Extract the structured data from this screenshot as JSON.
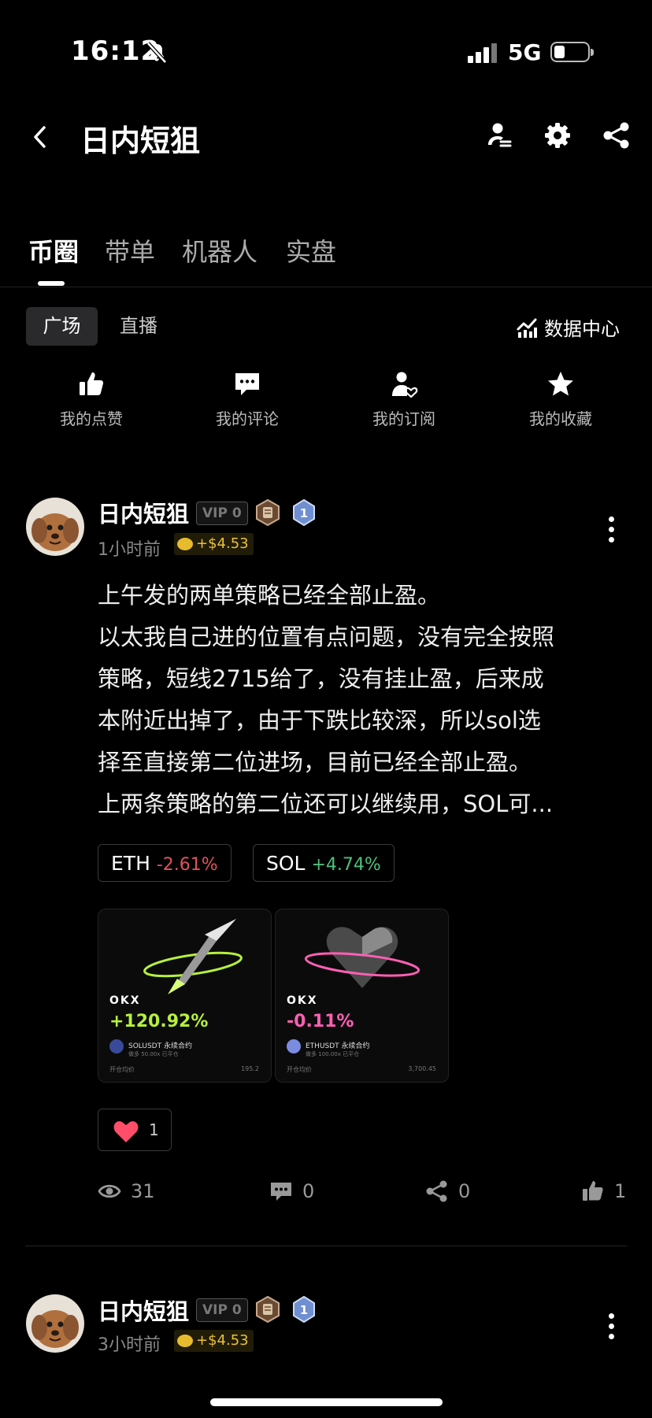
{
  "status_bar": {
    "time": "16:12",
    "network": "5G"
  },
  "header": {
    "title": "日内短狙"
  },
  "tabs": [
    {
      "label": "币圈",
      "active": true
    },
    {
      "label": "带单",
      "active": false
    },
    {
      "label": "机器人",
      "active": false
    },
    {
      "label": "实盘",
      "active": false
    }
  ],
  "subtabs": {
    "active": "广场",
    "other": "直播",
    "data_center": "数据中心"
  },
  "quick_actions": [
    {
      "label": "我的点赞",
      "icon": "thumbs-up-icon"
    },
    {
      "label": "我的评论",
      "icon": "comment-icon"
    },
    {
      "label": "我的订阅",
      "icon": "subscribe-icon"
    },
    {
      "label": "我的收藏",
      "icon": "star-icon"
    }
  ],
  "posts": [
    {
      "author": "日内短狙",
      "vip": "VIP 0",
      "badge_level": "1",
      "time": "1小时前",
      "profit": "+$4.53",
      "text_lines": [
        "上午发的两单策略已经全部止盈。",
        "以太我自己进的位置有点问题，没有完全按照",
        "策略，短线2715给了，没有挂止盈，后来成",
        "本附近出掉了，由于下跌比较深，所以sol选",
        "择至直接第二位进场，目前已经全部止盈。",
        "上两条策略的第二位还可以继续用，SOL可..."
      ],
      "tickers": [
        {
          "symbol": "ETH",
          "change": "-2.61%",
          "direction": "down"
        },
        {
          "symbol": "SOL",
          "change": "+4.74%",
          "direction": "up"
        }
      ],
      "cards": [
        {
          "brand": "OKX",
          "pct": "+120.92%",
          "pct_color": "#b6f03c",
          "pair": "SOLUSDT 永续合约",
          "pair_sub": "做多  50.00x  已平仓",
          "meta_label": "开仓均价",
          "meta_value": "195.2"
        },
        {
          "brand": "OKX",
          "pct": "-0.11%",
          "pct_color": "#ff5fb4",
          "pair": "ETHUSDT 永续合约",
          "pair_sub": "做多  100.00x  已平仓",
          "meta_label": "开仓均价",
          "meta_value": "3,700.45"
        }
      ],
      "reaction_count": "1",
      "stats": {
        "views": "31",
        "comments": "0",
        "shares": "0",
        "likes": "1"
      }
    },
    {
      "author": "日内短狙",
      "vip": "VIP 0",
      "badge_level": "1",
      "time": "3小时前",
      "profit": "+$4.53"
    }
  ],
  "colors": {
    "up": "#4fc07c",
    "down": "#e0525e",
    "gold": "#e9c13a",
    "background": "#000000"
  }
}
